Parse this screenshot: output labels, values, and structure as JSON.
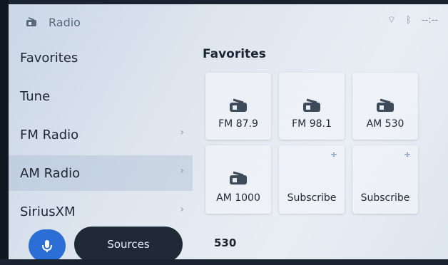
{
  "header": {
    "title": "Radio",
    "clock": "--:--"
  },
  "sidebar": {
    "items": [
      {
        "label": "Favorites",
        "has_chevron": false
      },
      {
        "label": "Tune",
        "has_chevron": false
      },
      {
        "label": "FM Radio",
        "has_chevron": true
      },
      {
        "label": "AM Radio",
        "has_chevron": true
      },
      {
        "label": "SiriusXM",
        "has_chevron": true
      }
    ],
    "selected_index": 3
  },
  "bottom": {
    "sources_label": "Sources"
  },
  "main": {
    "title": "Favorites",
    "tiles": [
      {
        "label": "FM 87.9",
        "icon": "radio-icon"
      },
      {
        "label": "FM 98.1",
        "icon": "radio-icon"
      },
      {
        "label": "AM 530",
        "icon": "radio-icon"
      },
      {
        "label": "AM 1000",
        "icon": "radio-icon"
      },
      {
        "label": "Subscribe",
        "icon": "plus-minus-icon"
      },
      {
        "label": "Subscribe",
        "icon": "plus-minus-icon"
      }
    ],
    "now_playing": "530"
  },
  "colors": {
    "accent": "#2b6fd6",
    "dark_button": "#1f2a36"
  }
}
